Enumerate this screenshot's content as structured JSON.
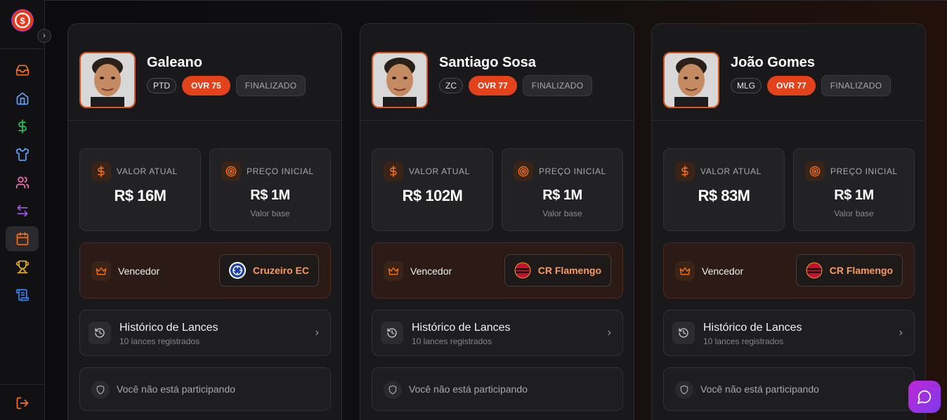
{
  "app": {
    "logo_text": "$",
    "logo_name": "club-logo"
  },
  "sidebar": {
    "items": [
      {
        "name": "inbox",
        "icon": "inbox-icon",
        "color": "#f97316"
      },
      {
        "name": "home",
        "icon": "home-icon",
        "color": "#60a5fa"
      },
      {
        "name": "finance",
        "icon": "dollar-icon",
        "color": "#22c55e"
      },
      {
        "name": "squad",
        "icon": "shirt-icon",
        "color": "#60a5fa"
      },
      {
        "name": "users",
        "icon": "users-icon",
        "color": "#f472b6"
      },
      {
        "name": "transfers",
        "icon": "arrows-exchange-icon",
        "color": "#a855f7"
      },
      {
        "name": "calendar",
        "icon": "calendar-icon",
        "color": "#f97316",
        "active": true
      },
      {
        "name": "trophies",
        "icon": "trophy-icon",
        "color": "#eab308"
      },
      {
        "name": "scroll",
        "icon": "scroll-icon",
        "color": "#3b82f6"
      }
    ],
    "logout_icon": "logout-icon"
  },
  "cards": [
    {
      "name": "Galeano",
      "position": "PTD",
      "ovr": "OVR 75",
      "status": "FINALIZADO",
      "current_value_label": "VALOR ATUAL",
      "current_value": "R$ 16M",
      "initial_price_label": "PREÇO INICIAL",
      "initial_price": "R$ 1M",
      "initial_price_sub": "Valor base",
      "winner_label": "Vencedor",
      "winner_club": "Cruzeiro EC",
      "winner_crest": "cruzeiro",
      "history_title": "Histórico de Lances",
      "history_sub": "10 lances registrados",
      "participation": "Você não está participando"
    },
    {
      "name": "Santiago Sosa",
      "position": "ZC",
      "ovr": "OVR 77",
      "status": "FINALIZADO",
      "current_value_label": "VALOR ATUAL",
      "current_value": "R$ 102M",
      "initial_price_label": "PREÇO INICIAL",
      "initial_price": "R$ 1M",
      "initial_price_sub": "Valor base",
      "winner_label": "Vencedor",
      "winner_club": "CR Flamengo",
      "winner_crest": "flamengo",
      "history_title": "Histórico de Lances",
      "history_sub": "10 lances registrados",
      "participation": "Você não está participando"
    },
    {
      "name": "João Gomes",
      "position": "MLG",
      "ovr": "OVR 77",
      "status": "FINALIZADO",
      "current_value_label": "VALOR ATUAL",
      "current_value": "R$ 83M",
      "initial_price_label": "PREÇO INICIAL",
      "initial_price": "R$ 1M",
      "initial_price_sub": "Valor base",
      "winner_label": "Vencedor",
      "winner_club": "CR Flamengo",
      "winner_crest": "flamengo",
      "history_title": "Histórico de Lances",
      "history_sub": "10 lances registrados",
      "participation": "Você não está participando"
    }
  ],
  "colors": {
    "accent": "#e3421b",
    "club_text": "#ff9a5a"
  }
}
